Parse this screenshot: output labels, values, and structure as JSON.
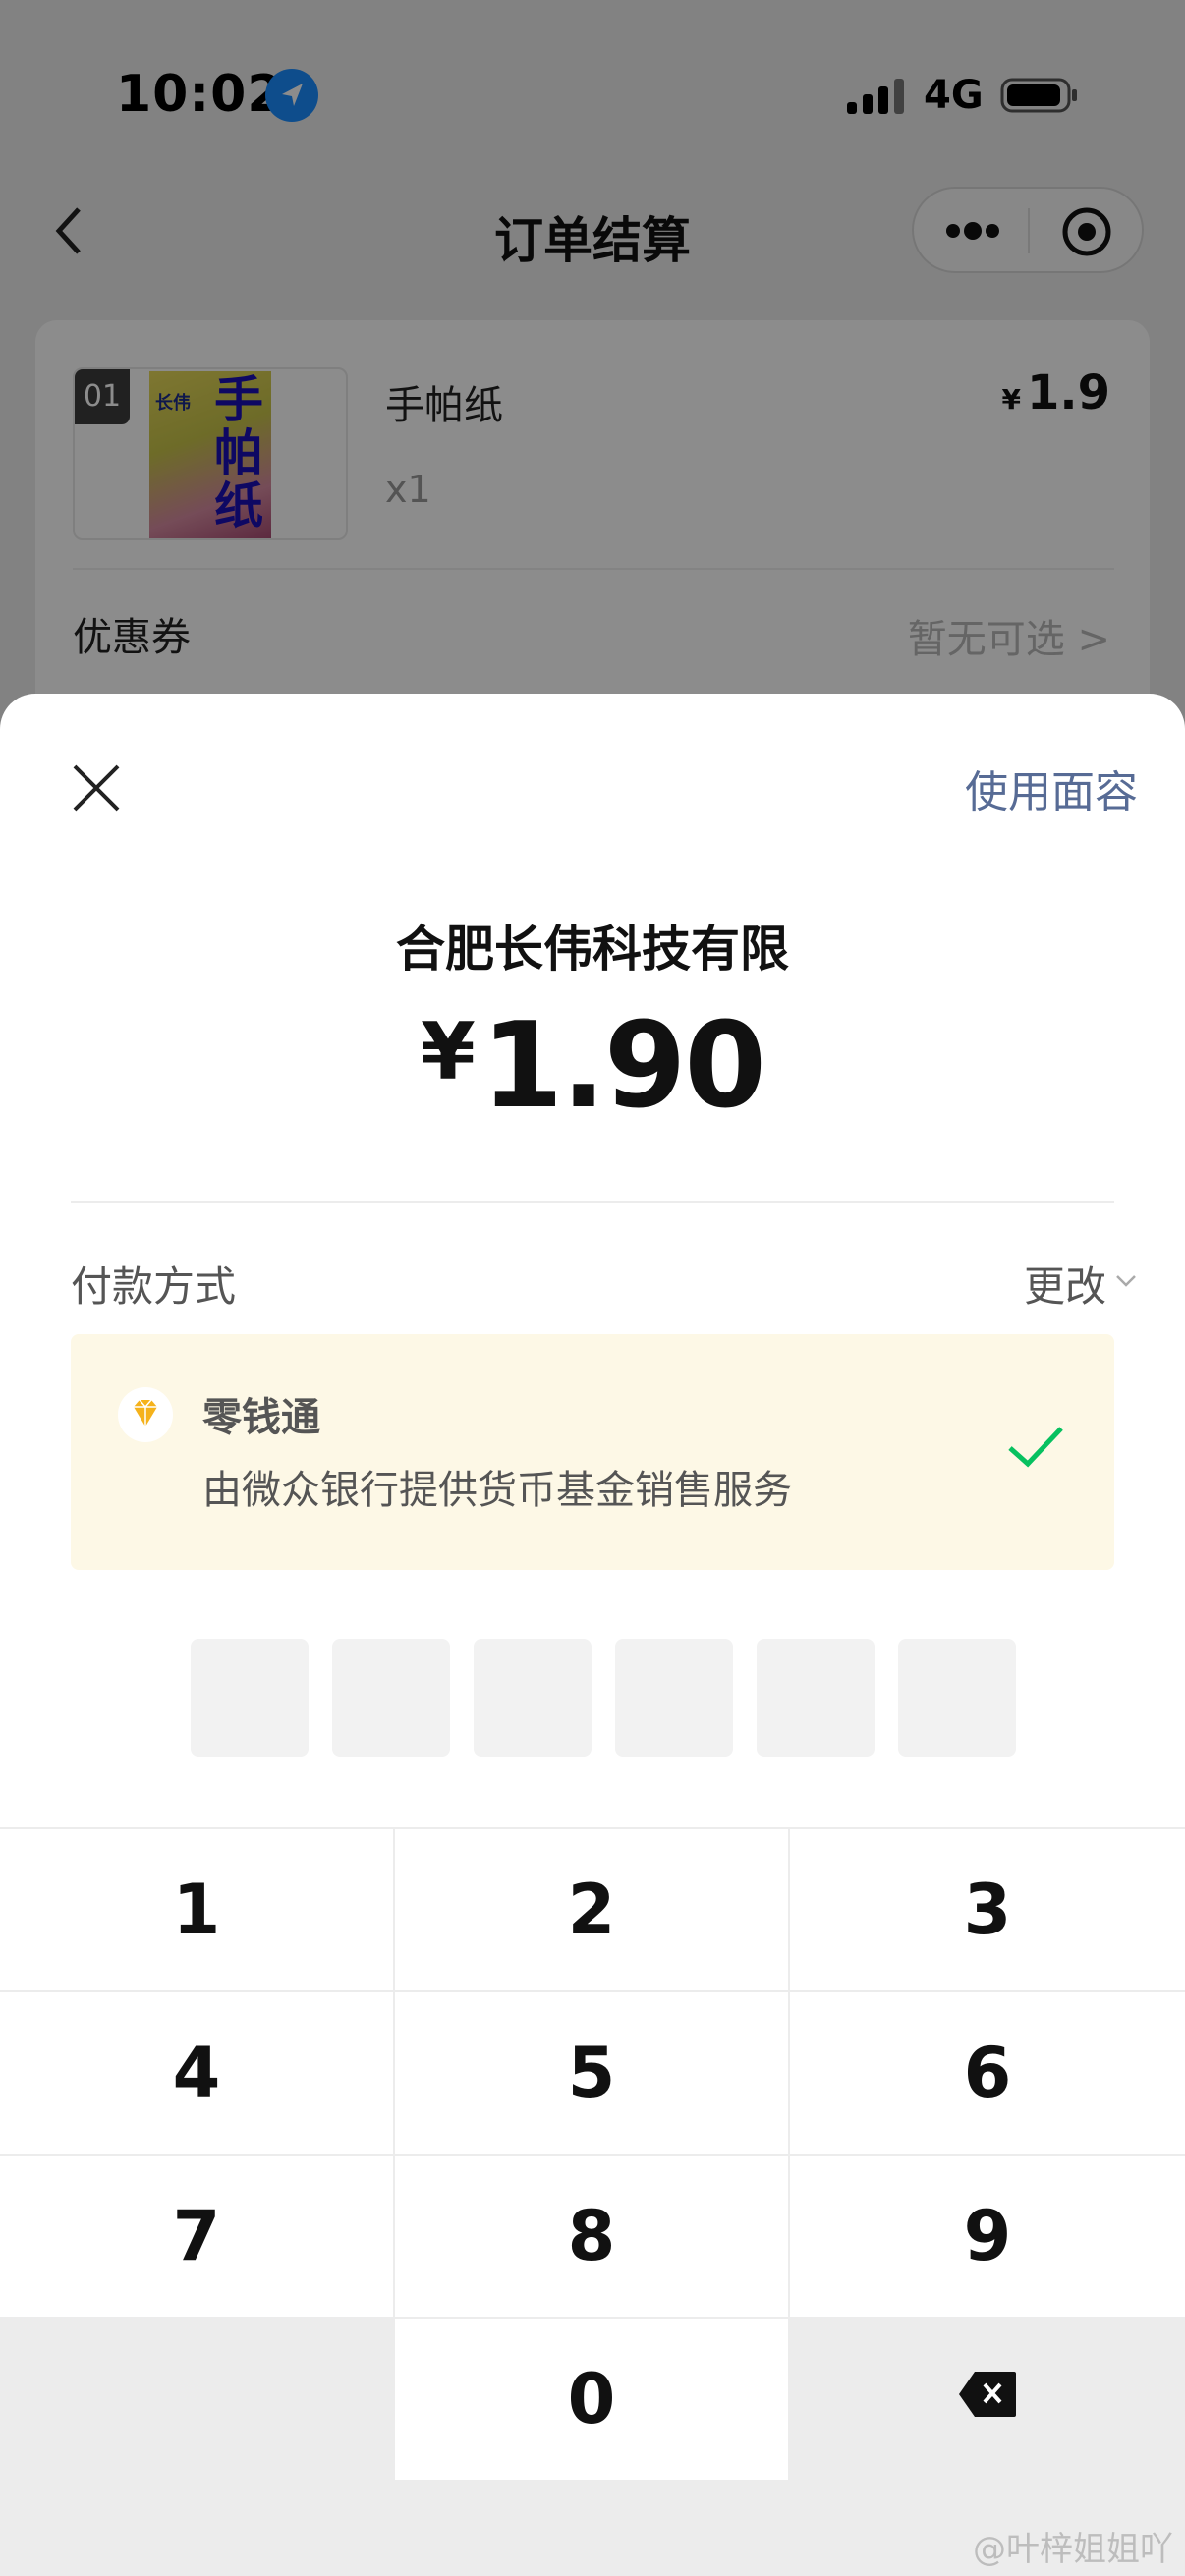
{
  "status_bar": {
    "time": "10:02",
    "network": "4G"
  },
  "nav": {
    "title": "订单结算"
  },
  "order": {
    "item_index": "01",
    "product_name": "手帕纸",
    "package_brand": "长伟",
    "package_title": "手帕纸",
    "quantity": "x1",
    "price_symbol": "¥",
    "price": "1.9",
    "coupon_label": "优惠券",
    "coupon_value": "暂无可选 >"
  },
  "payment_sheet": {
    "face_id_label": "使用面容",
    "merchant": "合肥长伟科技有限",
    "currency_symbol": "¥",
    "amount": "1.90",
    "method_label": "付款方式",
    "change_label": "更改",
    "method_title": "零钱通",
    "method_desc": "由微众银行提供货币基金销售服务",
    "accent_color": "#07c160",
    "link_color": "#576b95"
  },
  "keypad": {
    "keys": [
      "1",
      "2",
      "3",
      "4",
      "5",
      "6",
      "7",
      "8",
      "9",
      "0"
    ],
    "delete_icon": "backspace-icon"
  },
  "watermark": "@叶梓姐姐吖"
}
